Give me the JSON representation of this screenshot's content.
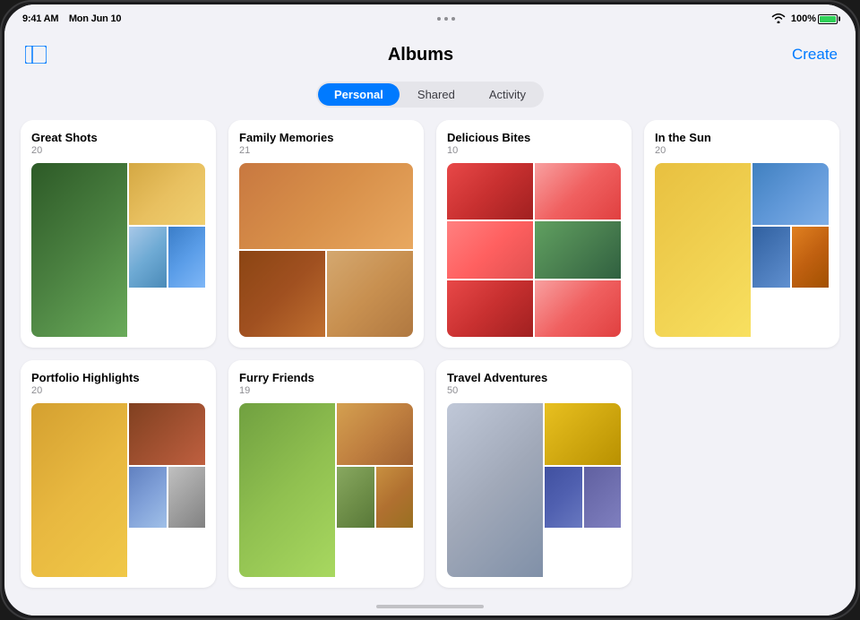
{
  "device": {
    "time": "9:41 AM",
    "date": "Mon Jun 10",
    "battery_percent": "100%",
    "signal_bars": 3
  },
  "header": {
    "title": "Albums",
    "create_label": "Create",
    "sidebar_toggle_label": "Sidebar"
  },
  "tabs": {
    "personal_label": "Personal",
    "shared_label": "Shared",
    "activity_label": "Activity",
    "active": "Personal"
  },
  "albums": [
    {
      "id": "great-shots",
      "title": "Great Shots",
      "count": "20"
    },
    {
      "id": "family-memories",
      "title": "Family Memories",
      "count": "21"
    },
    {
      "id": "delicious-bites",
      "title": "Delicious Bites",
      "count": "10"
    },
    {
      "id": "in-the-sun",
      "title": "In the Sun",
      "count": "20"
    },
    {
      "id": "portfolio-highlights",
      "title": "Portfolio Highlights",
      "count": "20"
    },
    {
      "id": "furry-friends",
      "title": "Furry Friends",
      "count": "19"
    },
    {
      "id": "travel-adventures",
      "title": "Travel Adventures",
      "count": "50"
    }
  ]
}
